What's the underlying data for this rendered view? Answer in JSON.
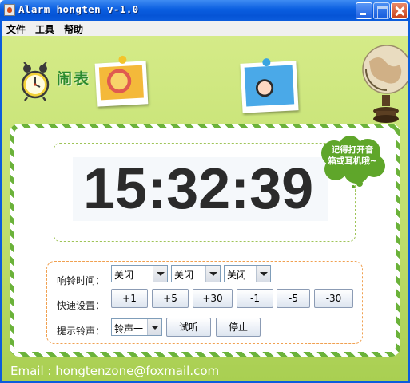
{
  "window": {
    "title": "Alarm hongten v-1.0"
  },
  "menu": {
    "items": [
      "文件",
      "工具",
      "帮助"
    ]
  },
  "header": {
    "brand_title": "闹表"
  },
  "clock": {
    "time": "15:32:39"
  },
  "hint_bubble": {
    "line1": "记得打开音",
    "line2": "箱或耳机哦~"
  },
  "controls": {
    "ring_time_label": "响铃时间：",
    "ring_time_selects": [
      "关闭",
      "关闭",
      "关闭"
    ],
    "quick_set_label": "快速设置：",
    "quick_buttons": [
      "+1",
      "+5",
      "+30",
      "-1",
      "-5",
      "-30"
    ],
    "ringtone_label": "提示铃声：",
    "ringtone_select": "铃声一",
    "preview_button": "试听",
    "stop_button": "停止"
  },
  "footer": {
    "email": "Email : hongtenzone@foxmail.com"
  },
  "colors": {
    "titlebar": "#0b5cdc",
    "background_green": "#bedd6a",
    "card_stripe": "#6bb23a",
    "brand_green": "#2b8a2e"
  }
}
